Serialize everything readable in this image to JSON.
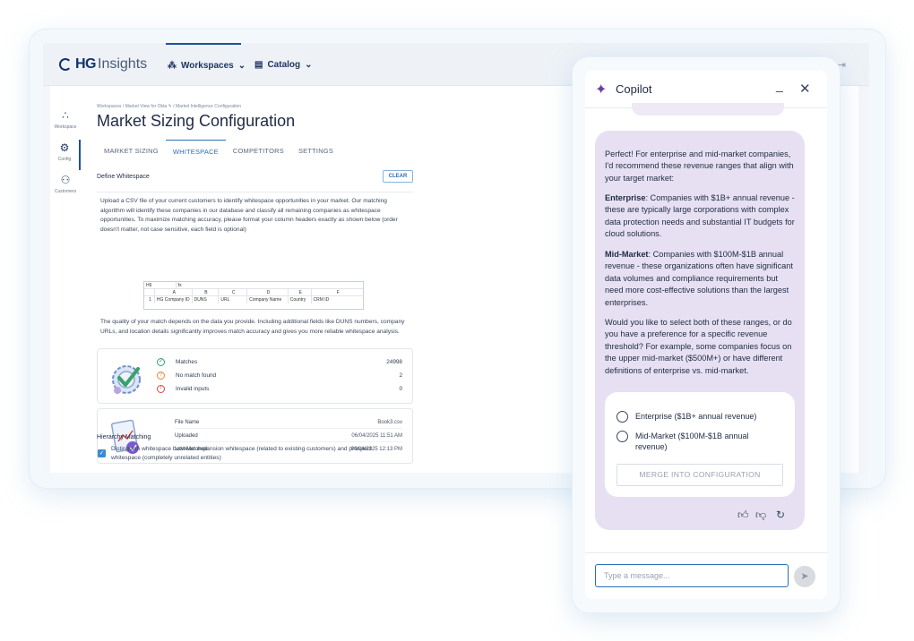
{
  "app": {
    "logo_hg": "HG",
    "logo_insights": "Insights",
    "nav": [
      {
        "label": "Workspaces",
        "icon": "workspaces-icon"
      },
      {
        "label": "Catalog",
        "icon": "catalog-icon"
      }
    ]
  },
  "sidebar": {
    "items": [
      {
        "label": "Workspace"
      },
      {
        "label": "Config"
      },
      {
        "label": "Customers"
      }
    ]
  },
  "breadcrumb": {
    "items": [
      "Workspaces",
      "Market View for Okta",
      "Market Intelligence Configuration"
    ]
  },
  "page": {
    "title": "Market Sizing Configuration",
    "tabs": [
      "MARKET SIZING",
      "WHITESPACE",
      "COMPETITORS",
      "SETTINGS"
    ],
    "active_tab": "WHITESPACE"
  },
  "whitespace": {
    "section_title": "Define Whitespace",
    "clear_label": "CLEAR",
    "intro": "Upload a CSV file of your current customers to identify whitespace opportunities in your market. Our matching algorithm will identify these companies in our database and classify all remaining companies as whitespace opportunities. To maximize matching accuracy, please format your column headers exactly as shown below (order doesn't matter, not case sensitive, each field is optional)",
    "sheet": {
      "cell_ref": "H6",
      "fx": "fx",
      "columns": [
        "A",
        "B",
        "C",
        "D",
        "E",
        "F"
      ],
      "row_num": "1",
      "headers": [
        "HG Company ID",
        "DUNS",
        "URL",
        "Company Name",
        "Country",
        "CRM ID"
      ]
    },
    "quality_note": "The quality of your match depends on the data you provide. Including additional fields like DUNS numbers, company URLs, and location details significantly improves match accuracy and gives you more reliable whitespace analysis.",
    "stats": [
      {
        "label": "Matches",
        "value": "24998",
        "icon": "check-circle-icon"
      },
      {
        "label": "No match found",
        "value": "2",
        "icon": "question-circle-icon"
      },
      {
        "label": "Invalid inputs",
        "value": "0",
        "icon": "alert-circle-icon"
      }
    ],
    "file": [
      {
        "label": "File Name",
        "value": "Book3.csv"
      },
      {
        "label": "Uploaded",
        "value": "06/04/2025 11:51 AM"
      },
      {
        "label": "Last Matched",
        "value": "06/04/2025 12:13 PM"
      }
    ],
    "hierarchy_title": "Hierarchy Matching",
    "hierarchy_text": "Distinguish whitespace between expansion whitespace (related to existing customers) and prospect whitespace (completely unrelated entities)"
  },
  "copilot": {
    "title": "Copilot",
    "intro": "Perfect! For enterprise and mid-market companies, I'd recommend these revenue ranges that align with your target market:",
    "enterprise_label": "Enterprise",
    "enterprise_text": ": Companies with $1B+ annual revenue - these are typically large corporations with complex data protection needs and substantial IT budgets for cloud solutions.",
    "midmarket_label": "Mid-Market",
    "midmarket_text": ": Companies with $100M-$1B annual revenue - these organizations often have significant data volumes and compliance requirements but need more cost-effective solutions than the largest enterprises.",
    "question": "Would you like to select both of these ranges, or do you have a preference for a specific revenue threshold? For example, some companies focus on the upper mid-market ($500M+) or have different definitions of enterprise vs. mid-market.",
    "options": [
      "Enterprise ($1B+ annual revenue)",
      "Mid-Market ($100M-$1B annual revenue)"
    ],
    "merge_label": "MERGE INTO CONFIGURATION",
    "input_placeholder": "Type a message..."
  },
  "colors": {
    "accent": "#2b6fb5",
    "navy": "#12336b",
    "copilot_bubble": "#e6e0f2"
  }
}
